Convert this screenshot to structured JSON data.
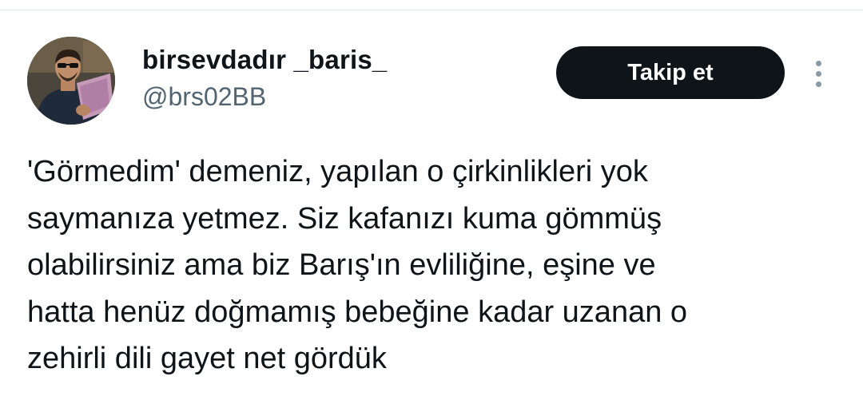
{
  "user": {
    "display_name": "birsevdadır _baris_",
    "handle": "@brs02BB"
  },
  "actions": {
    "follow_label": "Takip et",
    "more_icon": "more-vertical-icon"
  },
  "tweet": {
    "text": "'Görmedim' demeniz, yapılan o çirkinlikleri yok\nsaymanıza yetmez. Siz kafanızı kuma gömmüş\nolabilirsiniz ama biz Barış'ın evliliğine, eşine ve\nhatta henüz doğmamış bebeğine kadar uzanan o\nzehirli dili gayet net gördük"
  },
  "colors": {
    "text_primary": "#0f1419",
    "text_secondary": "#536471",
    "button_bg": "#0f1419",
    "button_text": "#ffffff",
    "icon_muted": "#8b98a5"
  }
}
